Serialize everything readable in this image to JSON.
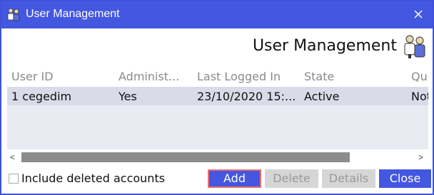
{
  "window": {
    "title": "User Management"
  },
  "header": {
    "title": "User Management"
  },
  "table": {
    "columns": [
      "User ID",
      "Administ...",
      "Last Logged In",
      "State",
      "Que"
    ],
    "rows": [
      [
        "1 cegedim",
        "Yes",
        "23/10/2020 15:...",
        "Active",
        "Not"
      ]
    ]
  },
  "scrollbar": {
    "left_arrow": "<",
    "right_arrow": ">"
  },
  "footer": {
    "include_deleted_label": "Include deleted accounts",
    "include_deleted_checked": false
  },
  "buttons": {
    "add": "Add",
    "delete": "Delete",
    "details": "Details",
    "close": "Close"
  },
  "colors": {
    "accent": "#4457e0",
    "focus_border": "#f06d6d",
    "disabled_bg": "#d6d6d6"
  },
  "icons": {
    "title": "users-icon",
    "header": "users-icon",
    "close": "close-icon"
  }
}
